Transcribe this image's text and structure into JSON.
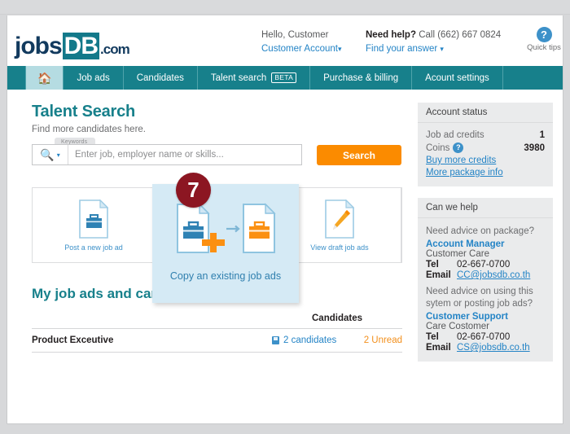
{
  "brand": {
    "logo_jobs": "jobs",
    "logo_db": "DB",
    "logo_dotcom": ".com",
    "teal": "#17808b",
    "orange": "#fb8b00",
    "link_blue": "#2484c6",
    "badge_red": "#8c1622"
  },
  "header": {
    "hello": "Hello, Customer",
    "account_link": "Customer Account",
    "need_help_strong": "Need help?",
    "need_help_rest": "Call (662) 667 0824",
    "find_answer": "Find your answer",
    "quick_tips_icon": "question-mark-circle-icon",
    "quick_tips_label": "Quick tips"
  },
  "nav": {
    "home_icon": "home-icon",
    "items": [
      {
        "label": "Job ads",
        "active": false
      },
      {
        "label": "Candidates",
        "active": false
      },
      {
        "label": "Talent search",
        "badge": "BETA",
        "active": false
      },
      {
        "label": "Purchase & billing",
        "active": false
      },
      {
        "label": "Acount settings",
        "active": false
      }
    ]
  },
  "main": {
    "title": "Talent Search",
    "subtitle": "Find more candidates here.",
    "search": {
      "keywords_tab": "Keywords",
      "magnifier_icon": "search-icon",
      "dropdown_icon": "chevron-down-icon",
      "placeholder": "Enter job, employer name or skills...",
      "value": "",
      "button_label": "Search"
    },
    "cards": [
      {
        "label": "Post a new job ad",
        "icon": "document-briefcase-icon"
      },
      {
        "label": "",
        "icon": ""
      },
      {
        "label": "View draft job ads",
        "icon": "document-pencil-icon"
      }
    ],
    "highlight_card": {
      "label": "Copy an existing job ads",
      "icon": "copy-job-ad-icon",
      "badge": "7"
    },
    "section_title": "My job ads and candidates",
    "table": {
      "columns": [
        "",
        "Candidates",
        ""
      ],
      "rows": [
        {
          "job_title": "Product Exceutive",
          "candidates_icon": "saved-candidates-icon",
          "candidates": "2 candidates",
          "unread": "2 Unread"
        }
      ]
    }
  },
  "rail": {
    "account_status": {
      "title": "Account status",
      "lines": [
        {
          "label": "Job ad credits",
          "value": "1",
          "info": false
        },
        {
          "label": "Coins",
          "value": "3980",
          "info": true,
          "info_icon": "question-mark-circle-icon"
        }
      ],
      "links": [
        "Buy more credits",
        "More package info"
      ]
    },
    "help": {
      "title": "Can we help",
      "block1": {
        "question": "Need advice on package?",
        "contact_link": "Account Manager",
        "contact_name": "Customer Care",
        "tel_key": "Tel",
        "tel_value": "02-667-0700",
        "email_key": "Email",
        "email_value": "CC@jobsdb.co.th"
      },
      "block2": {
        "question": "Need advice on using this sytem or posting job ads?",
        "contact_link": "Customer Support",
        "contact_name": "Care Costomer",
        "tel_key": "Tel",
        "tel_value": "02-667-0700",
        "email_key": "Email",
        "email_value": "CS@jobsdb.co.th"
      }
    }
  }
}
